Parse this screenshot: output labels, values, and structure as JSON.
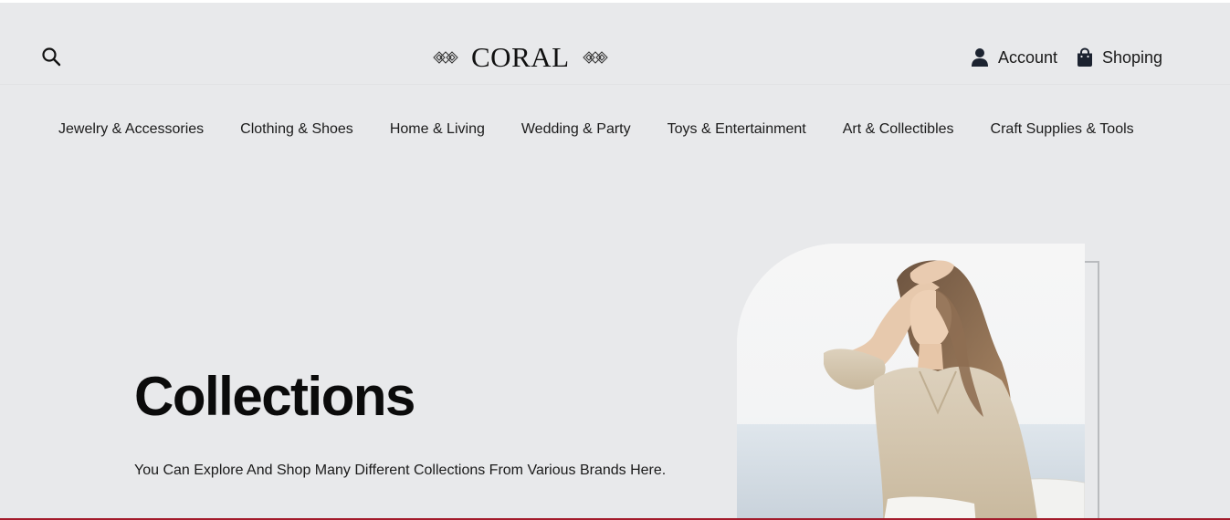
{
  "header": {
    "logo_text": "CORAL",
    "account_label": "Account",
    "cart_label": "Shoping",
    "icons": {
      "search": "search-icon",
      "account": "user-icon",
      "cart": "shopping-bag-icon",
      "logo_ornament": "diamond-ornament-icon"
    }
  },
  "nav": {
    "items": [
      {
        "label": "Jewelry & Accessories"
      },
      {
        "label": "Clothing & Shoes"
      },
      {
        "label": "Home & Living"
      },
      {
        "label": "Wedding & Party"
      },
      {
        "label": "Toys & Entertainment"
      },
      {
        "label": "Art & Collectibles"
      },
      {
        "label": "Craft Supplies & Tools"
      }
    ]
  },
  "hero": {
    "title": "Collections",
    "subtitle": "You Can Explore And Shop Many Different Collections From Various Brands Here."
  },
  "colors": {
    "background": "#e8e9eb",
    "text": "#111111",
    "accent_bottom": "#a31b2b"
  }
}
